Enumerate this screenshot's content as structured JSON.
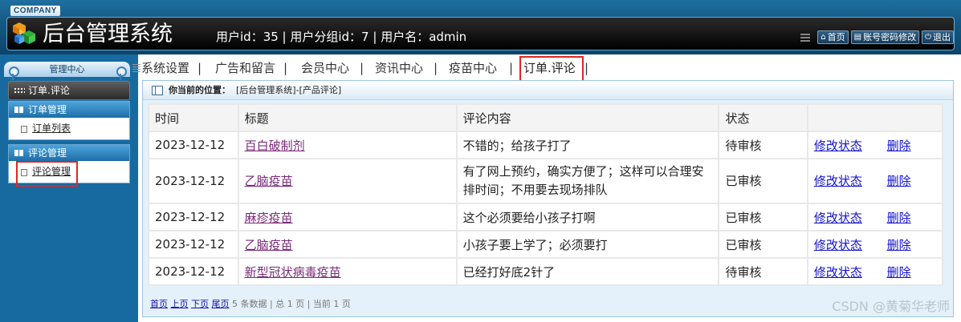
{
  "header": {
    "company": "COMPANY",
    "title": "后台管理系统",
    "user_info": "用户id：35 | 用户分组id：7 | 用户名：admin",
    "tools": [
      {
        "icon": "home-icon",
        "label": "首页"
      },
      {
        "icon": "account-icon",
        "label": "账号密码修改"
      },
      {
        "icon": "logout-icon",
        "label": "退出"
      }
    ]
  },
  "sidebar": {
    "panel_title": "管理中心",
    "current_module": "订单.评论",
    "groups": [
      {
        "title": "订单管理",
        "items": [
          {
            "label": "订单列表"
          }
        ]
      },
      {
        "title": "评论管理",
        "items": [
          {
            "label": "评论管理"
          }
        ]
      }
    ]
  },
  "nav": {
    "items": [
      "系统设置",
      "广告和留言",
      "会员中心",
      "资讯中心",
      "疫苗中心",
      "订单.评论"
    ],
    "separator": "|",
    "active_index": 5
  },
  "breadcrumb": {
    "label": "你当前的位置：",
    "path": "[后台管理系统]-[产品评论]"
  },
  "table": {
    "columns": [
      "时间",
      "标题",
      "评论内容",
      "状态",
      ""
    ],
    "rows": [
      {
        "time": "2023-12-12",
        "title": "百白破制剂",
        "content": "不错的；给孩子打了",
        "status": "待审核",
        "edit": "修改状态",
        "delete": "删除"
      },
      {
        "time": "2023-12-12",
        "title": "乙脑疫苗",
        "content": "有了网上预约，确实方便了；这样可以合理安排时间；不用要去现场排队",
        "status": "已审核",
        "edit": "修改状态",
        "delete": "删除"
      },
      {
        "time": "2023-12-12",
        "title": "麻疹疫苗",
        "content": "这个必须要给小孩子打啊",
        "status": "已审核",
        "edit": "修改状态",
        "delete": "删除"
      },
      {
        "time": "2023-12-12",
        "title": "乙脑疫苗",
        "content": "小孩子要上学了；必须要打",
        "status": "已审核",
        "edit": "修改状态",
        "delete": "删除"
      },
      {
        "time": "2023-12-12",
        "title": "新型冠状病毒疫苗",
        "content": "已经打好底2针了",
        "status": "待审核",
        "edit": "修改状态",
        "delete": "删除"
      }
    ]
  },
  "pager": {
    "first": "首页",
    "prev": "上页",
    "next": "下页",
    "last": "尾页",
    "summary": "5 条数据 | 总 1 页 | 当前 1 页"
  },
  "watermark": "CSDN @黄菊华老师",
  "colors": {
    "pending": "#e01010",
    "header_bg": "#155a86",
    "sidebar_bg": "#166aa0",
    "highlight": "#e02525"
  }
}
